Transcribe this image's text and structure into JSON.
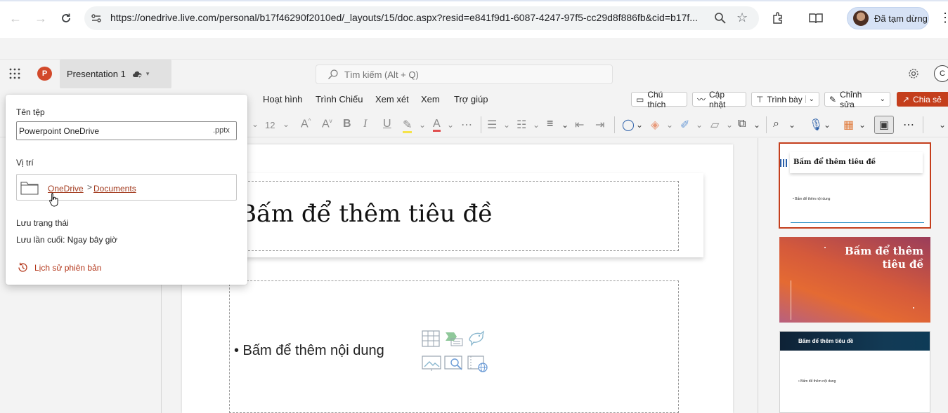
{
  "browser": {
    "url": "https://onedrive.live.com/personal/b17f46290f2010ed/_layouts/15/doc.aspx?resid=e841f9d1-6087-4247-97f5-cc29d8f886fb&cid=b17f...",
    "profile_label": "Đã tạm dừng"
  },
  "app": {
    "file_title": "Presentation 1",
    "search_placeholder": "Tìm kiếm (Alt + Q)",
    "account_initial": "C"
  },
  "ribbon": {
    "tabs": [
      "Hoạt hình",
      "Trình Chiếu",
      "Xem xét",
      "Xem",
      "Trợ giúp"
    ],
    "comments_label": "Chú thích",
    "catchup_label": "Cập nhật",
    "present_label": "Trình bày",
    "editing_label": "Chỉnh sửa",
    "share_label": "Chia sẻ"
  },
  "toolbar": {
    "font_size": "12"
  },
  "flyout": {
    "filename_label": "Tên tệp",
    "filename_value": "Powerpoint OneDrive",
    "extension": ".pptx",
    "location_label": "Vị trí",
    "location_root": "OneDrive",
    "location_sep": ">",
    "location_folder": "Documents",
    "save_status_label": "Lưu trạng thái",
    "last_saved": "Lưu lần cuối: Ngay bây giờ",
    "version_history": "Lịch sử phiên bản"
  },
  "slide": {
    "title_placeholder": "Bấm để thêm tiêu đề",
    "content_placeholder": "• Bấm để thêm nội dung"
  },
  "thumbnails": [
    {
      "title": "Bấm để thêm tiêu đề",
      "body": "• Bấm để thêm nội dung"
    },
    {
      "title_line1": "Bấm để thêm",
      "title_line2": "tiêu đề"
    },
    {
      "title": "Bấm để thêm tiêu đề",
      "body": "• Bấm để thêm nội dung"
    }
  ],
  "colors": {
    "accent": "#c43e1c",
    "link": "#a33b1f"
  }
}
